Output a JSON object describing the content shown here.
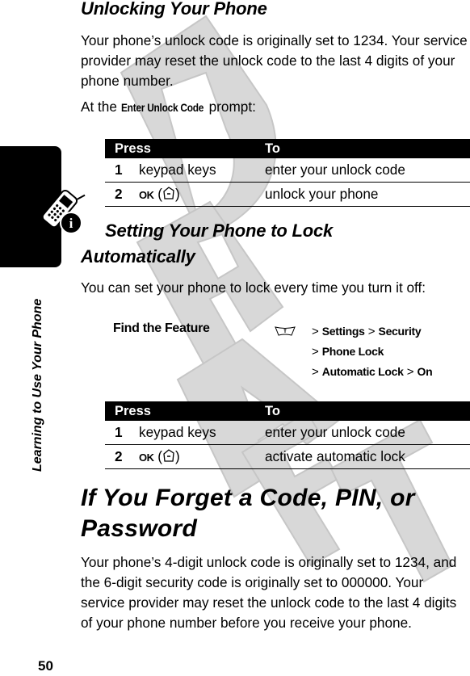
{
  "sidebar": {
    "section_title": "Learning to Use Your Phone",
    "page_number": "50",
    "tab_icon": "phone-info-icon"
  },
  "unlocking": {
    "heading": "Unlocking Your Phone",
    "intro": "Your phone’s unlock code is originally set to 1234. Your service provider may reset the unlock code to the last 4 digits of your phone number.",
    "prompt_prefix": "At the ",
    "prompt_term": "Enter Unlock Code",
    "prompt_suffix": " prompt:",
    "table": {
      "headers": [
        "Press",
        "To"
      ],
      "rows": [
        {
          "num": "1",
          "press": "keypad keys",
          "to": "enter your unlock code"
        },
        {
          "num": "2",
          "press_key": "OK",
          "press_icon": "center-select-key-icon",
          "to": "unlock your phone"
        }
      ]
    }
  },
  "auto_lock": {
    "heading_line1": "Setting Your Phone to Lock",
    "heading_line2": "Automatically",
    "intro": "You can set your phone to lock every time you turn it off:",
    "find_feature": {
      "label": "Find the Feature",
      "icon": "menu-key-icon",
      "path": [
        "Settings",
        "Security",
        "Phone Lock",
        "Automatic Lock",
        "On"
      ],
      "separator": ">"
    },
    "table": {
      "headers": [
        "Press",
        "To"
      ],
      "rows": [
        {
          "num": "1",
          "press": "keypad keys",
          "to": "enter your unlock code"
        },
        {
          "num": "2",
          "press_key": "OK",
          "press_icon": "center-select-key-icon",
          "to": "activate automatic lock"
        }
      ]
    }
  },
  "forget": {
    "heading_line1": "If You Forget a Code, PIN, or",
    "heading_line2": "Password",
    "body": "Your phone’s 4-digit unlock code is originally set to 1234, and the 6-digit security code is originally set to 000000. Your service provider may reset the unlock code to the last 4 digits of your phone number before you receive your phone."
  },
  "watermark": {
    "text": "DRAFT",
    "color": "#c8c8c8"
  }
}
